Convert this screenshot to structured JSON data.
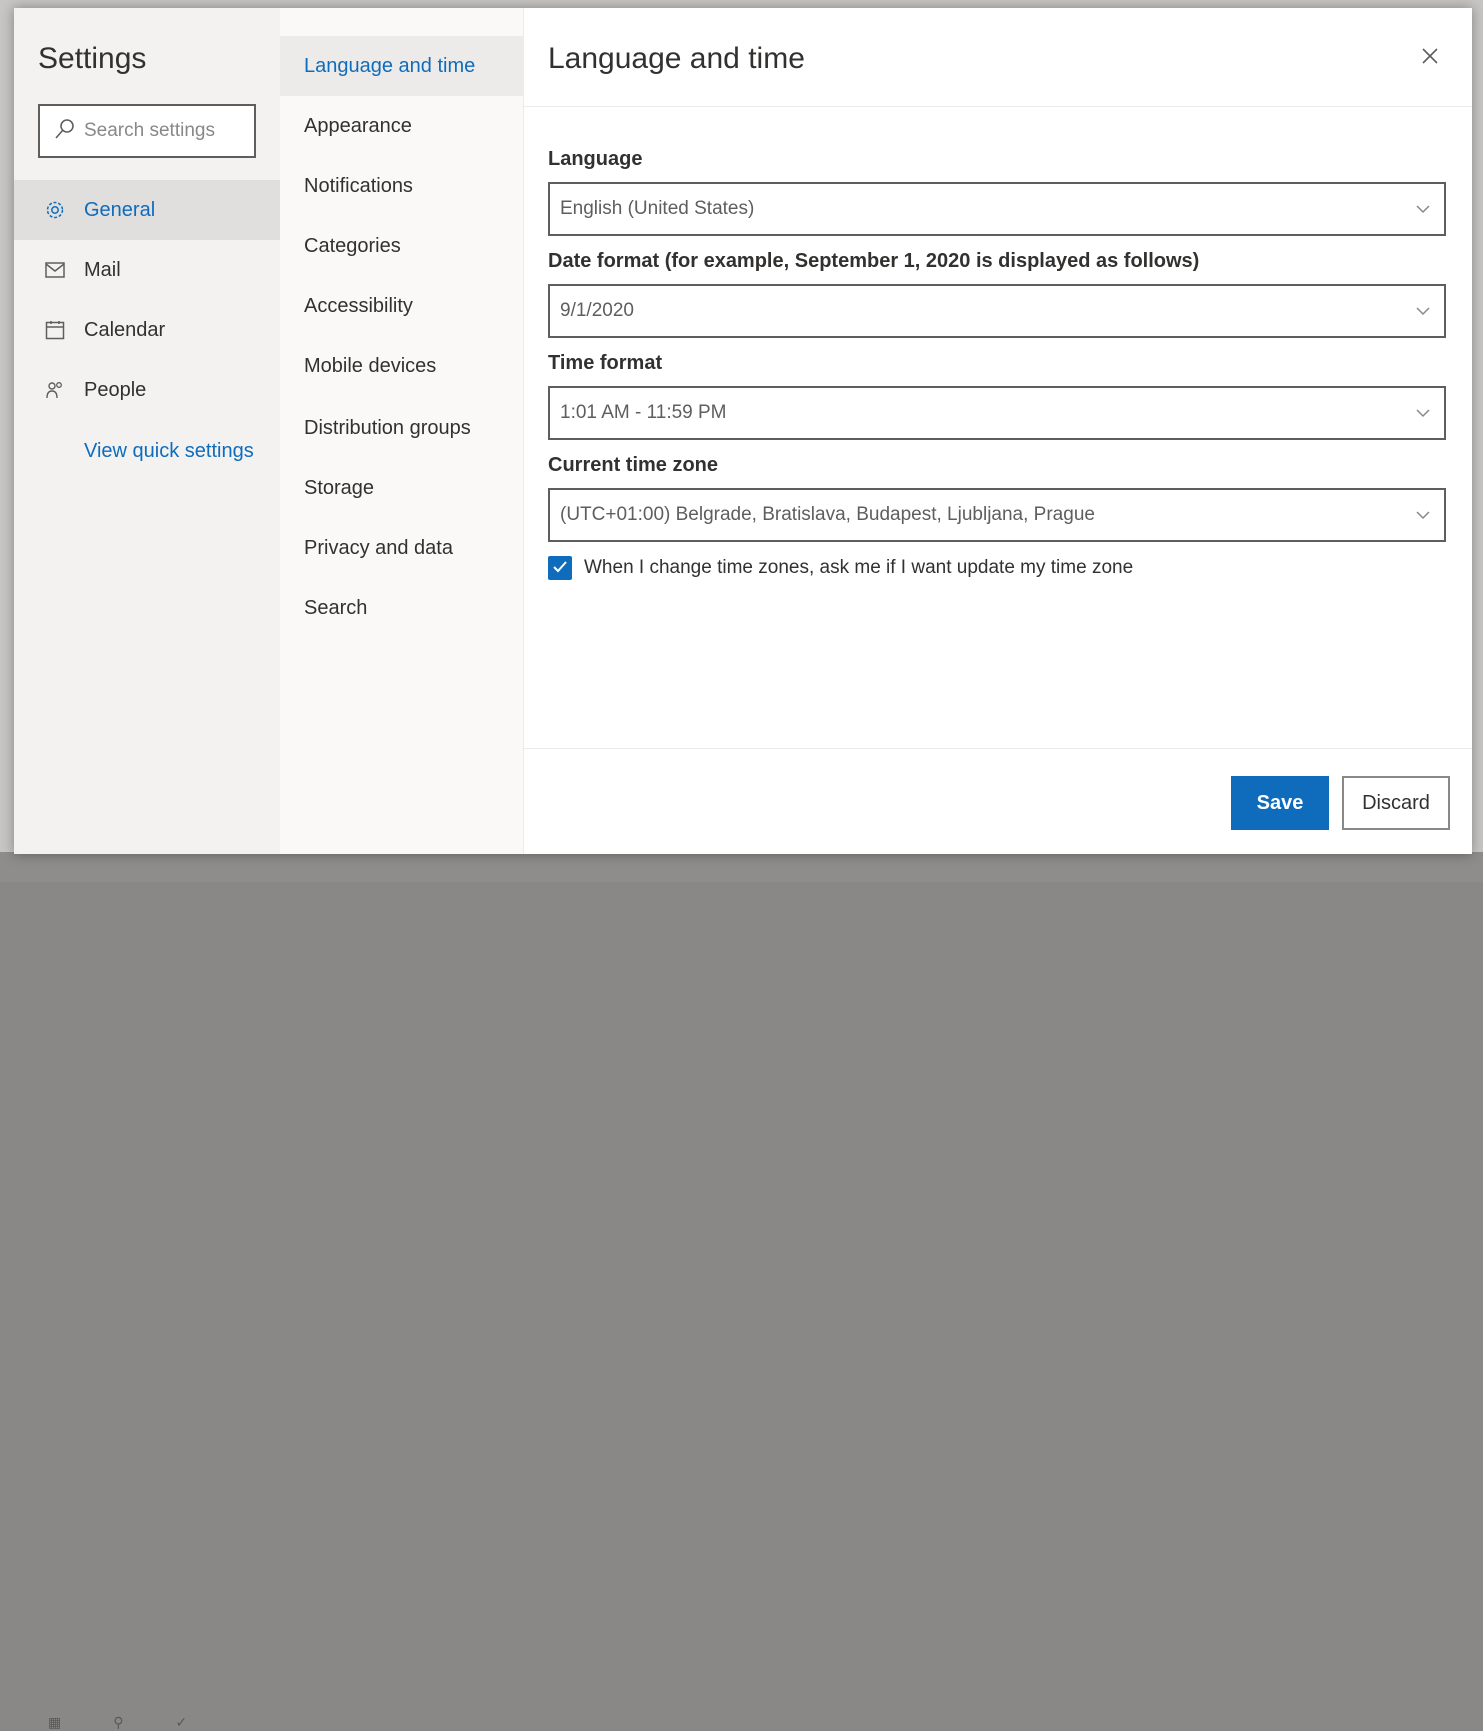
{
  "colors": {
    "accent": "#0f6cbd",
    "text": "#323130"
  },
  "settings": {
    "title": "Settings",
    "search_placeholder": "Search settings",
    "nav": [
      {
        "label": "General",
        "icon": "gear-icon",
        "active": true
      },
      {
        "label": "Mail",
        "icon": "mail-icon",
        "active": false
      },
      {
        "label": "Calendar",
        "icon": "calendar-icon",
        "active": false
      },
      {
        "label": "People",
        "icon": "people-icon",
        "active": false
      }
    ],
    "quick_settings_link": "View quick settings"
  },
  "general_menu": [
    {
      "label": "Language and time",
      "active": true
    },
    {
      "label": "Appearance"
    },
    {
      "label": "Notifications"
    },
    {
      "label": "Categories"
    },
    {
      "label": "Accessibility"
    },
    {
      "label": "Mobile devices"
    },
    {
      "label": "Distribution groups"
    },
    {
      "label": "Storage"
    },
    {
      "label": "Privacy and data"
    },
    {
      "label": "Search"
    }
  ],
  "pane": {
    "title": "Language and time",
    "language": {
      "label": "Language",
      "value": "English (United States)"
    },
    "date_format": {
      "label": "Date format (for example, September 1, 2020 is displayed as follows)",
      "value": "9/1/2020"
    },
    "time_format": {
      "label": "Time format",
      "value": "1:01 AM - 11:59 PM"
    },
    "time_zone": {
      "label": "Current time zone",
      "value": "(UTC+01:00) Belgrade, Bratislava, Budapest, Ljubljana, Prague"
    },
    "checkbox": {
      "label": "When I change time zones, ask me if I want update my time zone",
      "checked": true
    },
    "save_label": "Save",
    "discard_label": "Discard"
  }
}
